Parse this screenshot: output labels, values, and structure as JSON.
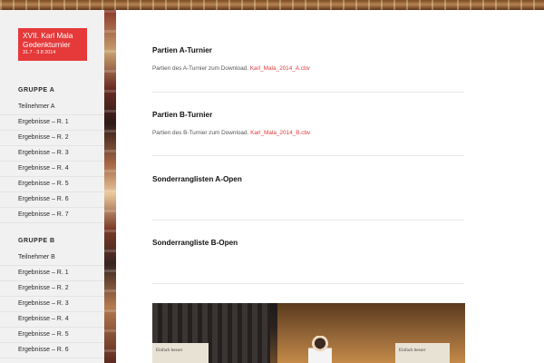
{
  "site": {
    "title_line1": "XVII. Karl Mala",
    "title_line2": "Gedenkturnier",
    "dates": "31.7 - 3.8 2014"
  },
  "sidebar": {
    "group_a": {
      "heading": "GRUPPE A",
      "items": [
        "Teilnehmer A",
        "Ergebnisse – R. 1",
        "Ergebnisse – R. 2",
        "Ergebnisse – R. 3",
        "Ergebnisse – R. 4",
        "Ergebnisse – R. 5",
        "Ergebnisse – R. 6",
        "Ergebnisse – R. 7"
      ]
    },
    "group_b": {
      "heading": "GRUPPE B",
      "items": [
        "Teilnehmer B",
        "Ergebnisse – R. 1",
        "Ergebnisse – R. 2",
        "Ergebnisse – R. 3",
        "Ergebnisse – R. 4",
        "Ergebnisse – R. 5",
        "Ergebnisse – R. 6"
      ]
    }
  },
  "posts": [
    {
      "title": "Partien A-Turnier",
      "text": "Partien des A-Turnier zum Download.",
      "link": "Karl_Mala_2014_A.cbv"
    },
    {
      "title": "Partien B-Turnier",
      "text": "Partien des B-Turnier zum Download.",
      "link": "Karl_Mala_2014_B.cbv"
    },
    {
      "title": "Sonderranglisten A-Open"
    },
    {
      "title": "Sonderrangliste B-Open"
    }
  ],
  "photo": {
    "caption_left": "Einfach besser",
    "caption_right": "Einfach besser"
  }
}
